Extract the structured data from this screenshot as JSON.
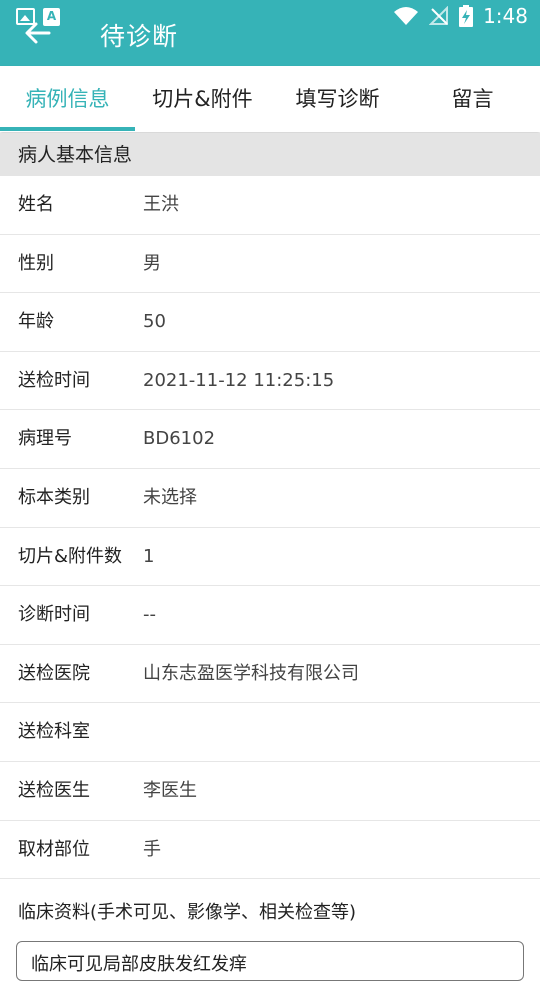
{
  "app": {
    "title": "待诊断",
    "clock": "1:48"
  },
  "tabs": [
    {
      "label": "病例信息"
    },
    {
      "label": "切片&附件"
    },
    {
      "label": "填写诊断"
    },
    {
      "label": "留言"
    }
  ],
  "section": {
    "title": "病人基本信息"
  },
  "rows": [
    {
      "label": "姓名",
      "value": "王洪"
    },
    {
      "label": "性别",
      "value": "男"
    },
    {
      "label": "年龄",
      "value": "50"
    },
    {
      "label": "送检时间",
      "value": "2021-11-12 11:25:15"
    },
    {
      "label": "病理号",
      "value": "BD6102"
    },
    {
      "label": "标本类别",
      "value": "未选择"
    },
    {
      "label": "切片&附件数",
      "value": "1"
    },
    {
      "label": "诊断时间",
      "value": "--"
    },
    {
      "label": "送检医院",
      "value": "山东志盈医学科技有限公司"
    },
    {
      "label": "送检科室",
      "value": ""
    },
    {
      "label": "送检医生",
      "value": "李医生"
    },
    {
      "label": "取材部位",
      "value": "手"
    }
  ],
  "clinical": {
    "label": "临床资料(手术可见、影像学、相关检查等)",
    "value": "临床可见局部皮肤发红发痒"
  },
  "colors": {
    "accent": "#36b3b7",
    "section_bg": "#e4e4e4"
  }
}
